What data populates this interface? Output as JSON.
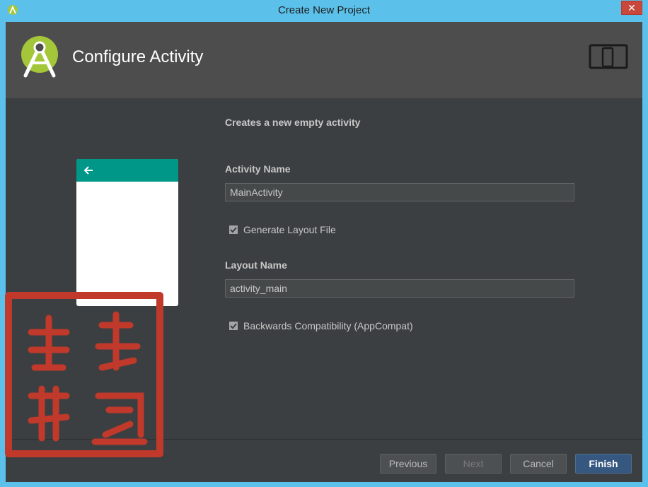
{
  "window": {
    "title": "Create New Project",
    "close_label": "✕"
  },
  "header": {
    "title": "Configure Activity"
  },
  "main": {
    "description": "Creates a new empty activity",
    "activity_name_label": "Activity Name",
    "activity_name_value": "MainActivity",
    "generate_layout_label": "Generate Layout File",
    "layout_name_label": "Layout Name",
    "layout_name_value": "activity_main",
    "backwards_compat_label": "Backwards Compatibility (AppCompat)"
  },
  "buttons": {
    "previous": "Previous",
    "next": "Next",
    "cancel": "Cancel",
    "finish": "Finish"
  },
  "watermark": {
    "text": "刘伟鹏作"
  },
  "colors": {
    "titlebar": "#5bc0ea",
    "header": "#4d4d4d",
    "body": "#3c3f41",
    "preview_bar": "#009688",
    "android_green": "#a4c639",
    "close": "#c9473b",
    "primary_button": "#365880",
    "seal_red": "#c0392b"
  },
  "icons": {
    "app": "android-studio-icon",
    "logo": "android-studio-logo",
    "device": "device-tablet-phone-icon",
    "back": "back-arrow-icon",
    "check": "checkmark-icon"
  }
}
